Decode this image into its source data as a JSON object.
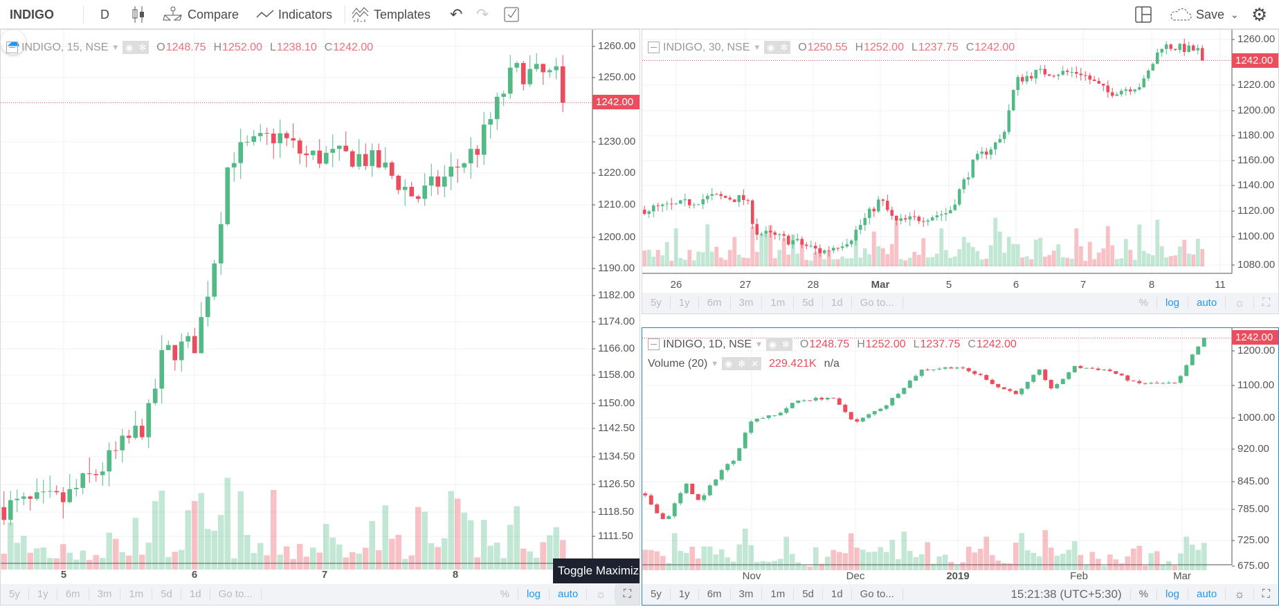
{
  "toolbar": {
    "symbol": "INDIGO",
    "interval": "D",
    "compare": "Compare",
    "indicators": "Indicators",
    "templates": "Templates",
    "save": "Save",
    "icons": [
      "candles-icon",
      "compare-icon",
      "indicators-icon",
      "templates-icon",
      "undo-icon",
      "redo-icon",
      "checkbox-icon",
      "layout-icon",
      "cloud-icon",
      "chevron-down-icon",
      "gear-icon"
    ]
  },
  "colors": {
    "up": "#53b987",
    "down": "#eb4d5c",
    "accent": "#2196f3",
    "active_border": "#1e88c7"
  },
  "bottom_bar": {
    "ranges": [
      "5y",
      "1y",
      "6m",
      "3m",
      "1m",
      "5d",
      "1d"
    ],
    "goto": "Go to...",
    "percent": "%",
    "log": "log",
    "auto": "auto"
  },
  "tooltip": "Toggle Maximize Chart",
  "charts": [
    {
      "title": "INDIGO, 15, NSE",
      "o": "1248.75",
      "h": "1252.00",
      "l": "1238.10",
      "c": "1242.00",
      "last": "1242.00",
      "price_labels": [
        "1260.00",
        "1250.00",
        "1230.00",
        "1220.00",
        "1210.00",
        "1200.00",
        "1190.00",
        "1182.00",
        "1174.00",
        "1166.00",
        "1158.00",
        "1150.00",
        "1142.50",
        "1134.50",
        "1126.50",
        "1118.50",
        "1111.50"
      ],
      "time_labels": [
        "5",
        "6",
        "7",
        "8"
      ]
    },
    {
      "title": "INDIGO, 30, NSE",
      "o": "1250.55",
      "h": "1252.00",
      "l": "1237.75",
      "c": "1242.00",
      "last": "1242.00",
      "price_labels": [
        "1260.00",
        "1220.00",
        "1200.00",
        "1180.00",
        "1160.00",
        "1140.00",
        "1120.00",
        "1100.00",
        "1080.00"
      ],
      "time_labels": [
        "26",
        "27",
        "28",
        "Mar",
        "5",
        "6",
        "7",
        "8",
        "11"
      ]
    },
    {
      "title": "INDIGO, 1D, NSE",
      "o": "1248.75",
      "h": "1252.00",
      "l": "1237.75",
      "c": "1242.00",
      "last": "1242.00",
      "volume_title": "Volume (20)",
      "volume_value": "229.421K",
      "volume_na": "n/a",
      "price_labels": [
        "1200.00",
        "1100.00",
        "1000.00",
        "920.00",
        "845.00",
        "785.00",
        "725.00",
        "675.00"
      ],
      "time_labels": [
        "Nov",
        "Dec",
        "2019",
        "Feb",
        "Mar"
      ],
      "clock": "15:21:38 (UTC+5:30)"
    }
  ]
}
